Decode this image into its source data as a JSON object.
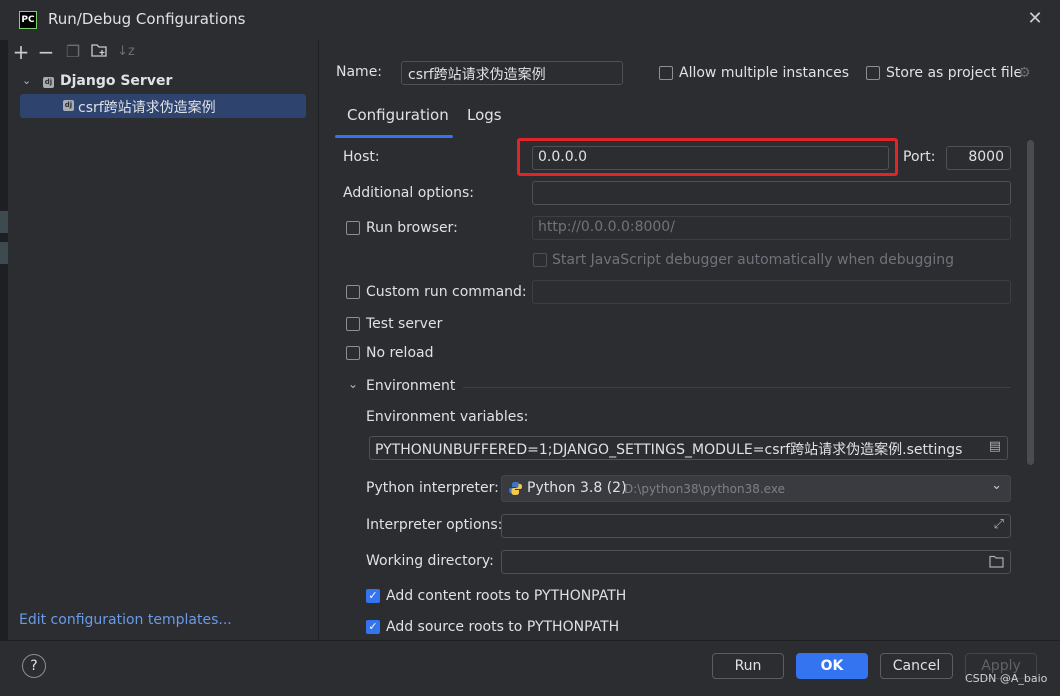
{
  "window": {
    "title": "Run/Debug Configurations",
    "app_badge": "PC"
  },
  "toolbar": {
    "icons": [
      "plus-icon",
      "minus-icon",
      "copy-icon",
      "new-folder-icon",
      "sort-icon"
    ]
  },
  "tree": {
    "group": "Django Server",
    "items": [
      {
        "label": "csrf跨站请求伪造案例",
        "selected": true
      }
    ]
  },
  "left_footer": {
    "edit_templates": "Edit configuration templates..."
  },
  "header": {
    "name_label": "Name:",
    "name_value": "csrf跨站请求伪造案例",
    "allow_multiple": {
      "label": "Allow multiple instances",
      "checked": false
    },
    "store_project": {
      "label": "Store as project file",
      "checked": false
    }
  },
  "tabs": [
    {
      "label": "Configuration",
      "active": true
    },
    {
      "label": "Logs",
      "active": false
    }
  ],
  "config": {
    "host_label": "Host:",
    "host_value": "0.0.0.0",
    "port_label": "Port:",
    "port_value": "8000",
    "additional_options_label": "Additional options:",
    "additional_options_value": "",
    "run_browser": {
      "label": "Run browser:",
      "checked": false,
      "placeholder": "http://0.0.0.0:8000/"
    },
    "js_debugger": {
      "label": "Start JavaScript debugger automatically when debugging",
      "checked": false,
      "enabled": false
    },
    "custom_run_command": {
      "label": "Custom run command:",
      "checked": false,
      "value": ""
    },
    "test_server": {
      "label": "Test server",
      "checked": false
    },
    "no_reload": {
      "label": "No reload",
      "checked": false
    },
    "environment_section": "Environment",
    "env_vars_label": "Environment variables:",
    "env_vars_value": "PYTHONUNBUFFERED=1;DJANGO_SETTINGS_MODULE=csrf跨站请求伪造案例.settings",
    "interpreter_label": "Python interpreter:",
    "interpreter_name": "Python 3.8 (2)",
    "interpreter_path": "D:\\python38\\python38.exe",
    "interpreter_options_label": "Interpreter options:",
    "working_dir_label": "Working directory:",
    "content_roots": {
      "label": "Add content roots to PYTHONPATH",
      "checked": true
    },
    "source_roots": {
      "label": "Add source roots to PYTHONPATH",
      "checked": true
    }
  },
  "footer": {
    "help": "?",
    "run": "Run",
    "ok": "OK",
    "cancel": "Cancel",
    "apply": "Apply",
    "watermark": "CSDN @A_baio"
  },
  "colors": {
    "accent": "#3574f0",
    "highlight_box": "#e0242a",
    "background": "#2b2d30"
  }
}
